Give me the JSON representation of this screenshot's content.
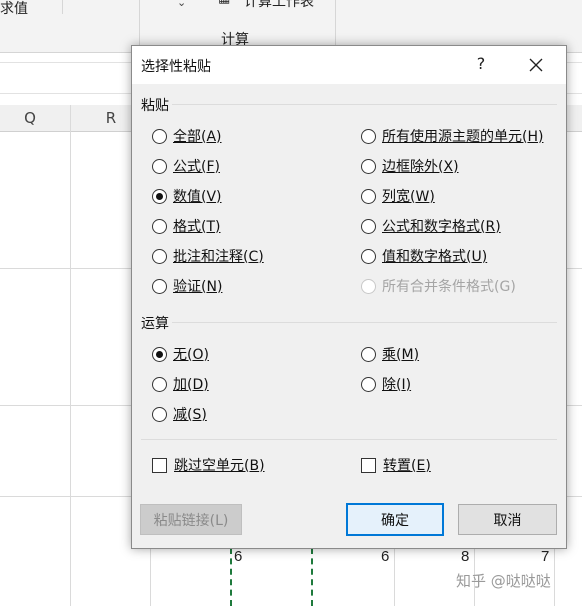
{
  "background": {
    "ribbon": {
      "left_text": "求值",
      "calc_sheet_label": "计算工作表",
      "group_label": "计算"
    },
    "columns": [
      "Q",
      "R"
    ],
    "cell_values": [
      "6",
      "6",
      "8",
      "7"
    ]
  },
  "dialog": {
    "title": "选择性粘贴",
    "help": "?",
    "paste_section": {
      "label": "粘贴",
      "left": [
        {
          "text": "全部",
          "key": "A",
          "checked": false
        },
        {
          "text": "公式",
          "key": "F",
          "checked": false
        },
        {
          "text": "数值",
          "key": "V",
          "checked": true
        },
        {
          "text": "格式",
          "key": "T",
          "checked": false
        },
        {
          "text": "批注和注释",
          "key": "C",
          "checked": false
        },
        {
          "text": "验证",
          "key": "N",
          "checked": false
        }
      ],
      "right": [
        {
          "text": "所有使用源主题的单元",
          "key": "H",
          "checked": false
        },
        {
          "text": "边框除外",
          "key": "X",
          "checked": false
        },
        {
          "text": "列宽",
          "key": "W",
          "checked": false
        },
        {
          "text": "公式和数字格式",
          "key": "R",
          "checked": false
        },
        {
          "text": "值和数字格式",
          "key": "U",
          "checked": false
        },
        {
          "text": "所有合并条件格式",
          "key": "G",
          "checked": false,
          "disabled": true
        }
      ]
    },
    "operation_section": {
      "label": "运算",
      "left": [
        {
          "text": "无",
          "key": "O",
          "checked": true
        },
        {
          "text": "加",
          "key": "D",
          "checked": false
        },
        {
          "text": "减",
          "key": "S",
          "checked": false
        }
      ],
      "right": [
        {
          "text": "乘",
          "key": "M",
          "checked": false
        },
        {
          "text": "除",
          "key": "I",
          "checked": false
        }
      ]
    },
    "checkboxes": [
      {
        "text": "跳过空单元",
        "key": "B",
        "checked": false
      },
      {
        "text": "转置",
        "key": "E",
        "checked": false
      }
    ],
    "buttons": {
      "paste_link": "粘贴链接(L)",
      "ok": "确定",
      "cancel": "取消"
    }
  },
  "watermark": "知乎 @哒哒哒",
  "colors": {
    "default_button_border": "#0078d7",
    "marching_ants": "#1e7a3c"
  }
}
